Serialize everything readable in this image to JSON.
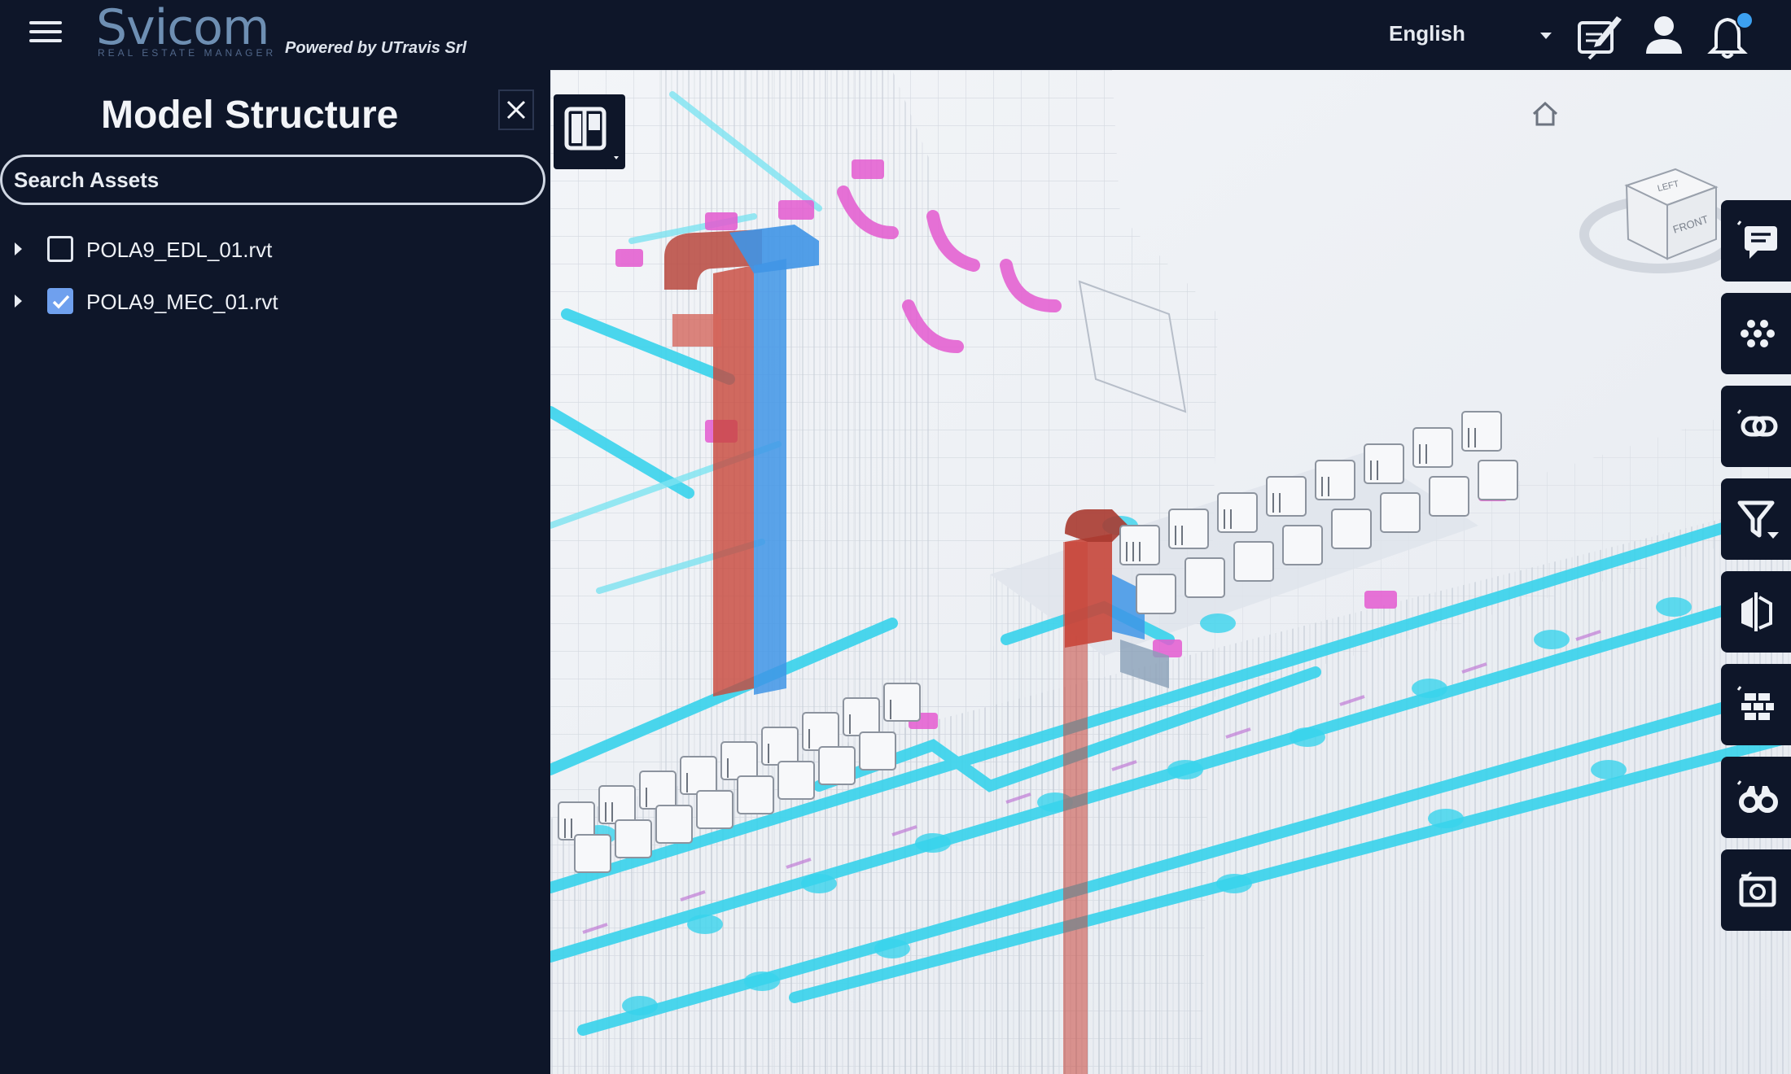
{
  "header": {
    "brand_name": "Svicom",
    "brand_subtitle": "REAL ESTATE MANAGER",
    "powered_by": "Powered by UTravis Srl",
    "language": "English",
    "icons": [
      "menu-icon",
      "report-icon",
      "user-icon",
      "bell-icon"
    ]
  },
  "sidebar": {
    "title": "Model Structure",
    "search_placeholder": "Search Assets",
    "items": [
      {
        "label": "POLA9_EDL_01.rvt",
        "checked": false
      },
      {
        "label": "POLA9_MEC_01.rvt",
        "checked": true
      }
    ]
  },
  "viewer": {
    "viewcube_labels": [
      "LEFT",
      "FRONT"
    ],
    "toolbar": [
      "comment-icon",
      "dots-grid-icon",
      "link-icon",
      "filter-icon",
      "compare-icon",
      "bricks-icon",
      "binoculars-icon",
      "camera-icon"
    ]
  },
  "colors": {
    "background": "#0e1629",
    "brand": "#6e8fb3",
    "accent": "#6fa0ee",
    "duct_cyan": "#38d3ec",
    "duct_red": "#c8463a",
    "duct_blue": "#3f95e6",
    "duct_magenta": "#e45ad0"
  }
}
